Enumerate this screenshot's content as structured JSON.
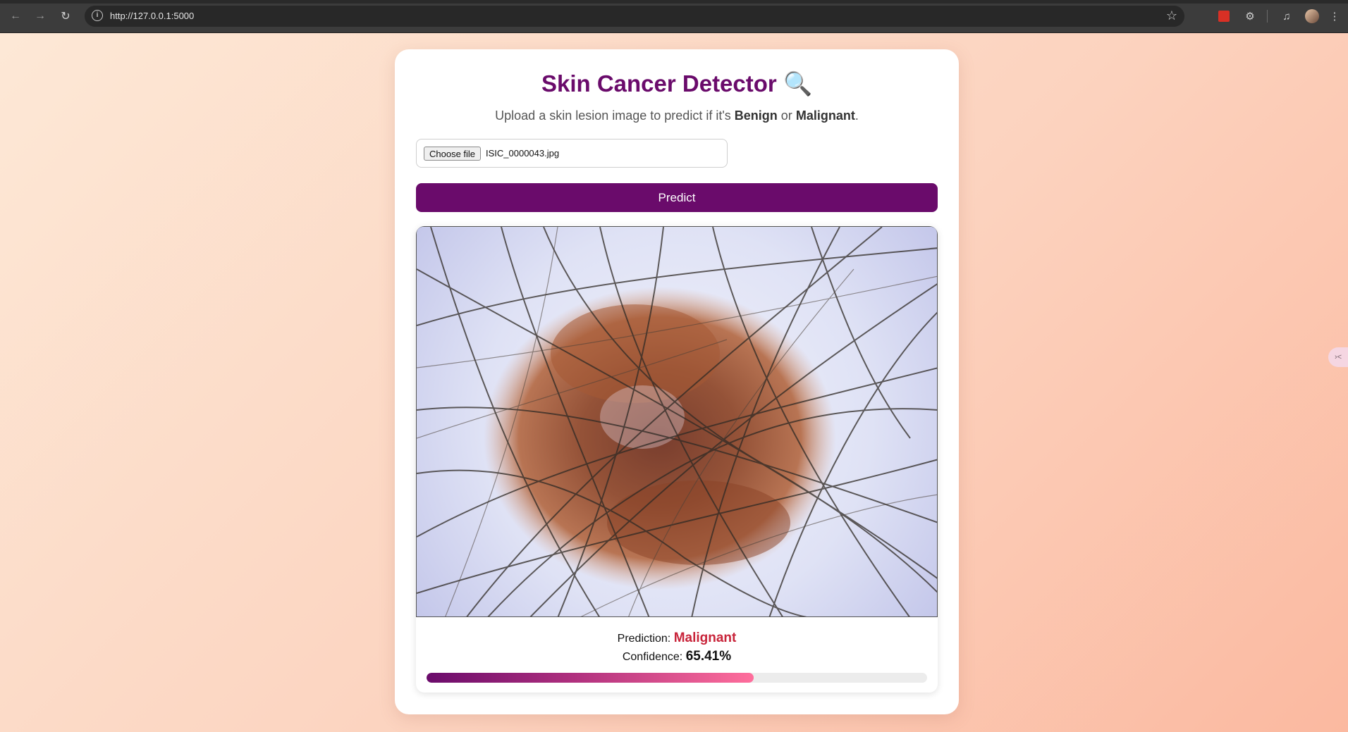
{
  "browser": {
    "url": "http://127.0.0.1:5000"
  },
  "header": {
    "title": "Skin Cancer Detector",
    "title_icon": "🔍",
    "subtitle_pre": "Upload a skin lesion image to predict if it's",
    "subtitle_benign": "Benign",
    "subtitle_or": "or",
    "subtitle_malignant": "Malignant",
    "subtitle_end": "."
  },
  "upload": {
    "button_label": "Choose file",
    "file_name": "ISIC_0000043.jpg"
  },
  "predict_button": "Predict",
  "result": {
    "prediction_label": "Prediction:",
    "prediction_value": "Malignant",
    "confidence_label": "Confidence:",
    "confidence_value": "65.41%",
    "confidence_fraction": 0.6541
  },
  "colors": {
    "accent": "#6a0b6b",
    "malignant": "#c8243a"
  }
}
